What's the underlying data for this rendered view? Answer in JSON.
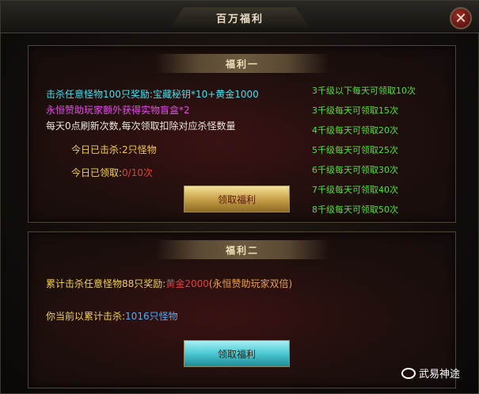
{
  "window": {
    "title": "百万福利",
    "close_label": "✕"
  },
  "panel1": {
    "header": "福利一",
    "reward_line_1": "击杀任意怪物100只奖励:宝藏秘钥*10+黄金1000",
    "reward_line_2": "永恒赞助玩家额外获得实物盲盒*2",
    "reward_line_3": "每天0点刷新次数,每次领取扣除对应杀怪数量",
    "killed_label": "今日已击杀:",
    "killed_value": "2只怪物",
    "claimed_label": "今日已领取:",
    "claimed_value": "0/10次",
    "claim_button": "领取福利",
    "tiers": [
      "3千级以下每天可领取10次",
      "3千级每天可领取15次",
      "4千级每天可领取20次",
      "5千级每天可领取25次",
      "6千级每天可领取30次",
      "7千级每天可领取40次",
      "8千级每天可领取50次"
    ]
  },
  "panel2": {
    "header": "福利二",
    "cumulative_label": "累计击杀任意怪物88只奖励:",
    "cumulative_reward": "黄金2000",
    "cumulative_extra": "(永恒赞助玩家双倍)",
    "current_label": "你当前以累计击杀:",
    "current_value": "1016只怪物",
    "claim_button": "领取福利"
  },
  "watermark": {
    "text": "武易神途"
  },
  "colors": {
    "cyan": "#3fe0f0",
    "magenta": "#e24ae8",
    "gold": "#f0c848",
    "red": "#e04040",
    "green": "#52e030",
    "blue": "#4ab0ff"
  }
}
